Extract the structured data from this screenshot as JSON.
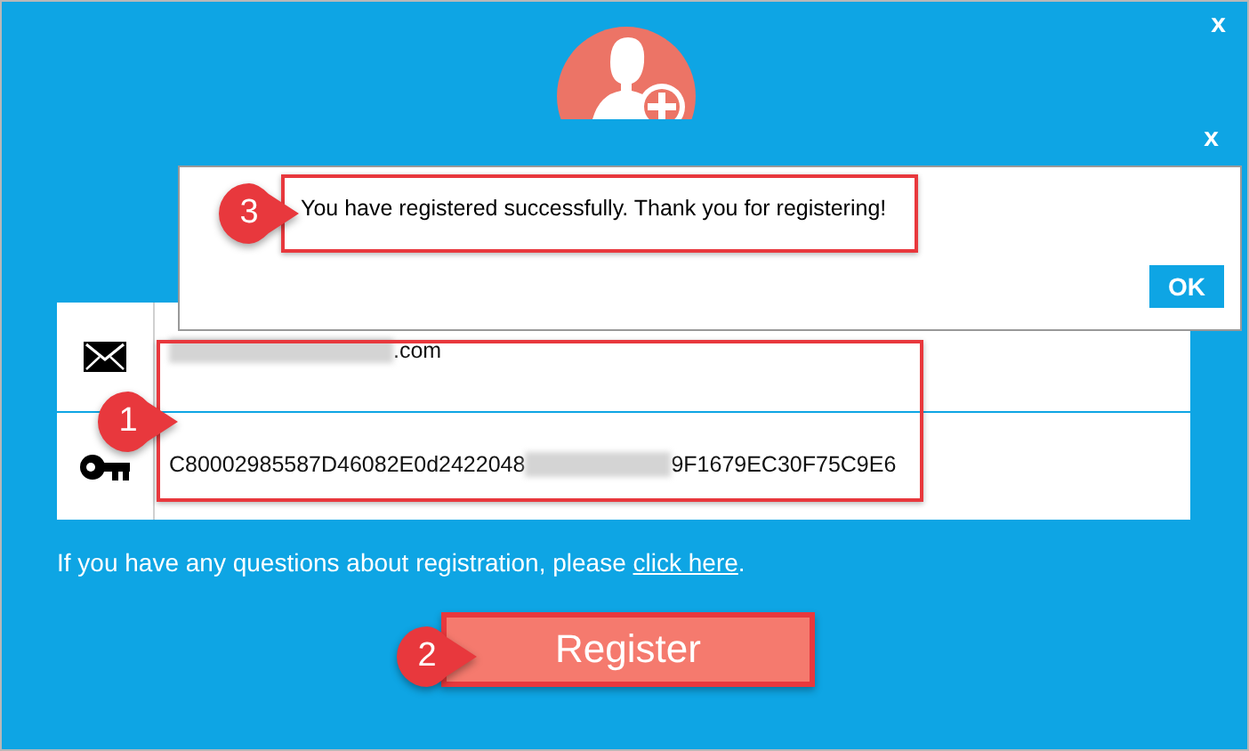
{
  "window": {
    "close": "x"
  },
  "dialog": {
    "close": "x",
    "message": "You have registered successfully. Thank you for registering!",
    "ok": "OK"
  },
  "fields": [
    {
      "kind": "email",
      "parts": [
        {
          "kind": "redacted"
        },
        {
          "kind": "text",
          "text": ".com"
        }
      ]
    },
    {
      "kind": "key",
      "parts": [
        {
          "kind": "text",
          "text": "C80002985587D46082E0d2422048"
        },
        {
          "kind": "redacted"
        },
        {
          "kind": "text",
          "text": "9F1679EC30F75C9E6"
        }
      ]
    }
  ],
  "help": {
    "text": "If you have any questions about registration, please ",
    "link": "click here",
    "end": "."
  },
  "register": "Register",
  "callouts": [
    {
      "number": "3"
    },
    {
      "number": "1"
    },
    {
      "number": "2"
    }
  ]
}
